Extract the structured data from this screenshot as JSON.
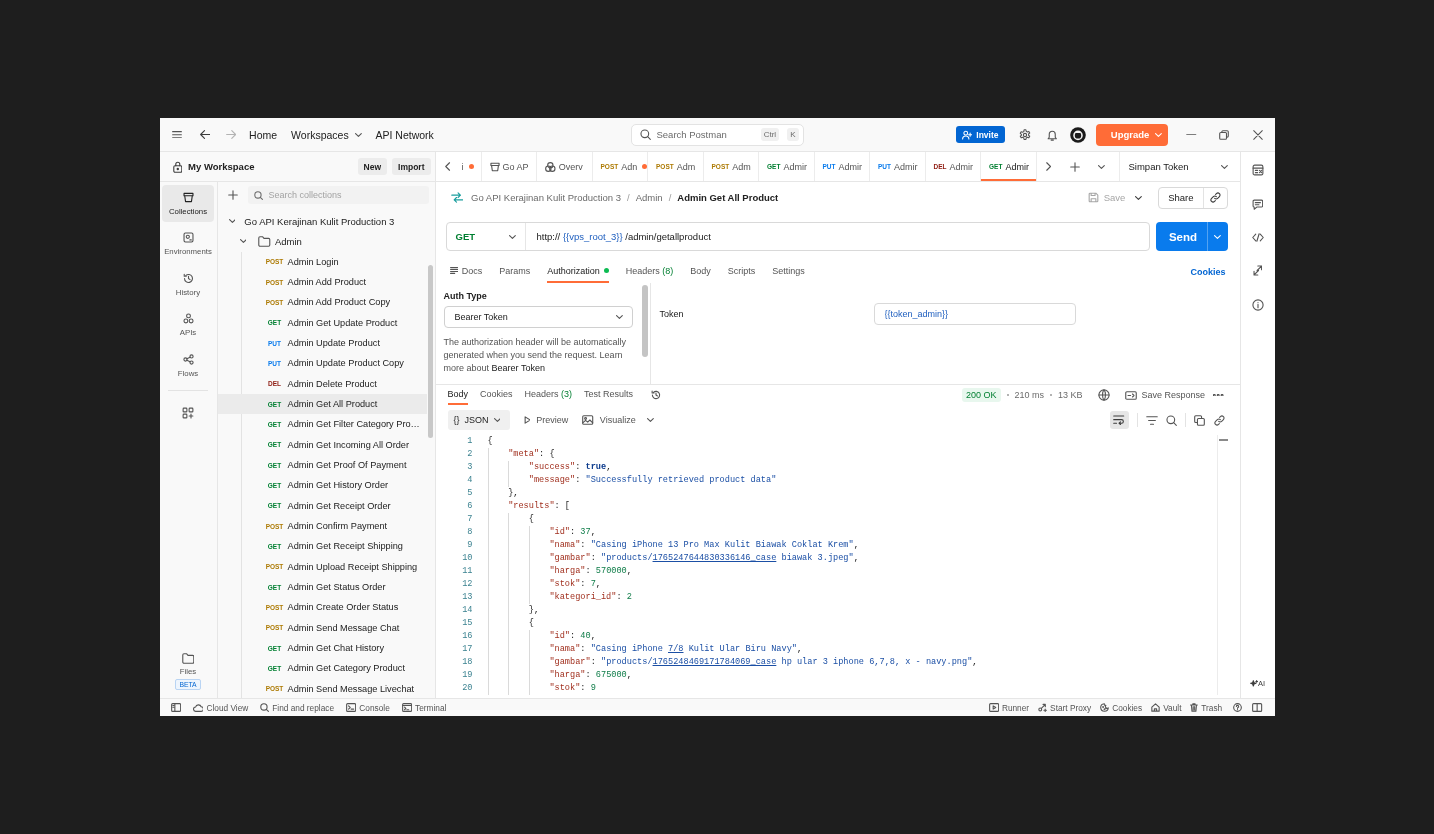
{
  "title_bar": {
    "nav": [
      {
        "label": "Home",
        "kind": "link"
      },
      {
        "label": "Workspaces",
        "kind": "menu"
      },
      {
        "label": "API Network",
        "kind": "link"
      }
    ],
    "search": {
      "placeholder": "Search Postman",
      "shortcut": [
        "Ctrl",
        "K"
      ]
    },
    "invite": "Invite",
    "upgrade": "Upgrade"
  },
  "sidebar": {
    "workspace": "My Workspace",
    "actions": [
      "New",
      "Import"
    ],
    "rail": [
      {
        "kind": "collections",
        "label": "Collections",
        "selected": true
      },
      {
        "kind": "environments",
        "label": "Environments",
        "selected": false
      },
      {
        "kind": "history",
        "label": "History",
        "selected": false
      },
      {
        "kind": "apis",
        "label": "APIs",
        "selected": false
      },
      {
        "kind": "flows",
        "label": "Flows",
        "selected": false
      }
    ],
    "files": {
      "label": "Files",
      "badge": "BETA"
    },
    "search": {
      "placeholder": "Search collections"
    },
    "tree": [
      {
        "kind": "collection",
        "name": "Go API Kerajinan Kulit Production 3",
        "expanded": true,
        "selected": false,
        "children": [
          {
            "kind": "folder",
            "name": "Admin",
            "expanded": true,
            "selected": false,
            "children": [
              {
                "kind": "post",
                "method": "POST",
                "name": "Admin Login",
                "selected": false
              },
              {
                "kind": "post",
                "method": "POST",
                "name": "Admin Add Product",
                "selected": false
              },
              {
                "kind": "post",
                "method": "POST",
                "name": "Admin Add Product Copy",
                "selected": false
              },
              {
                "kind": "get",
                "method": "GET",
                "name": "Admin Get Update Product",
                "selected": false
              },
              {
                "kind": "put",
                "method": "PUT",
                "name": "Admin Update Product",
                "selected": false
              },
              {
                "kind": "put",
                "method": "PUT",
                "name": "Admin Update Product Copy",
                "selected": false
              },
              {
                "kind": "del",
                "method": "DEL",
                "name": "Admin Delete Product",
                "selected": false
              },
              {
                "kind": "get",
                "method": "GET",
                "name": "Admin Get All Product",
                "selected": true
              },
              {
                "kind": "get",
                "method": "GET",
                "name": "Admin Get Filter Category Pro…",
                "selected": false
              },
              {
                "kind": "get",
                "method": "GET",
                "name": "Admin Get Incoming All Order",
                "selected": false
              },
              {
                "kind": "get",
                "method": "GET",
                "name": "Admin Get Proof Of Payment",
                "selected": false
              },
              {
                "kind": "get",
                "method": "GET",
                "name": "Admin Get History Order",
                "selected": false
              },
              {
                "kind": "get",
                "method": "GET",
                "name": "Admin Get Receipt Order",
                "selected": false
              },
              {
                "kind": "post",
                "method": "POST",
                "name": "Admin Confirm Payment",
                "selected": false
              },
              {
                "kind": "get",
                "method": "GET",
                "name": "Admin Get Receipt Shipping",
                "selected": false
              },
              {
                "kind": "post",
                "method": "POST",
                "name": "Admin Upload Receipt Shipping",
                "selected": false
              },
              {
                "kind": "get",
                "method": "GET",
                "name": "Admin Get Status Order",
                "selected": false
              },
              {
                "kind": "post",
                "method": "POST",
                "name": "Admin Create Order Status",
                "selected": false
              },
              {
                "kind": "post",
                "method": "POST",
                "name": "Admin Send Message Chat",
                "selected": false
              },
              {
                "kind": "get",
                "method": "GET",
                "name": "Admin Get Chat History",
                "selected": false
              },
              {
                "kind": "get",
                "method": "GET",
                "name": "Admin Get Category Product",
                "selected": false
              },
              {
                "kind": "post",
                "method": "POST",
                "name": "Admin Send Message Livechat",
                "selected": false
              }
            ]
          }
        ]
      }
    ]
  },
  "tabs": {
    "items": [
      {
        "kind": "plain",
        "label": "i",
        "unsaved": true,
        "selected": false
      },
      {
        "kind": "collection",
        "label": "Go AP",
        "unsaved": false,
        "selected": false
      },
      {
        "kind": "overview",
        "label": "Overv",
        "unsaved": false,
        "selected": false
      },
      {
        "kind": "post",
        "method": "POST",
        "label": "Adn",
        "unsaved": true,
        "selected": false
      },
      {
        "kind": "post",
        "method": "POST",
        "label": "Adm",
        "unsaved": false,
        "selected": false
      },
      {
        "kind": "post",
        "method": "POST",
        "label": "Adm",
        "unsaved": false,
        "selected": false
      },
      {
        "kind": "get",
        "method": "GET",
        "label": "Admir",
        "unsaved": false,
        "selected": false
      },
      {
        "kind": "put",
        "method": "PUT",
        "label": "Admir",
        "unsaved": false,
        "selected": false
      },
      {
        "kind": "put",
        "method": "PUT",
        "label": "Admir",
        "unsaved": false,
        "selected": false
      },
      {
        "kind": "del",
        "method": "DEL",
        "label": "Admir",
        "unsaved": false,
        "selected": false
      },
      {
        "kind": "get",
        "method": "GET",
        "label": "Admir",
        "unsaved": false,
        "selected": true
      }
    ],
    "environment": "Simpan Token"
  },
  "request": {
    "breadcrumb": {
      "items": [
        "Go API Kerajinan Kulit Production 3",
        "Admin",
        "Admin Get All Product"
      ],
      "separator": "/"
    },
    "save": {
      "label": "Save",
      "disabled": true
    },
    "share": "Share",
    "method": {
      "label": "GET",
      "kind": "get"
    },
    "url": [
      {
        "kind": "text",
        "text": "http://"
      },
      {
        "kind": "variable",
        "text": "{{vps_root_3}}"
      },
      {
        "kind": "text",
        "text": "/admin/getallproduct"
      }
    ],
    "send": "Send",
    "tabs": [
      {
        "kind": "docs",
        "label": "Docs",
        "selected": false,
        "indicator": false
      },
      {
        "kind": "plain",
        "label": "Params",
        "selected": false,
        "indicator": false
      },
      {
        "kind": "plain",
        "label": "Authorization",
        "selected": true,
        "indicator": true
      },
      {
        "kind": "plain",
        "label": "Headers",
        "count": "(8)",
        "selected": false,
        "indicator": false
      },
      {
        "kind": "plain",
        "label": "Body",
        "selected": false,
        "indicator": false
      },
      {
        "kind": "plain",
        "label": "Scripts",
        "selected": false,
        "indicator": false
      },
      {
        "kind": "plain",
        "label": "Settings",
        "selected": false,
        "indicator": false
      }
    ],
    "cookies": "Cookies",
    "auth": {
      "type_label": "Auth Type",
      "type": "Bearer Token",
      "description": "The authorization header will be automatically generated when you send the request. Learn more about",
      "link": "Bearer Token",
      "token_label": "Token",
      "token": "{{token_admin}}"
    }
  },
  "response": {
    "tabs": [
      {
        "label": "Body",
        "selected": true
      },
      {
        "label": "Cookies",
        "selected": false
      },
      {
        "label": "Headers",
        "count": "(3)",
        "selected": false
      },
      {
        "label": "Test Results",
        "selected": false
      }
    ],
    "status": "200 OK",
    "time": "210 ms",
    "size": "13 KB",
    "save_response": "Save Response",
    "format": {
      "icon": "{}",
      "label": "JSON"
    },
    "views": [
      {
        "kind": "preview",
        "label": "Preview"
      },
      {
        "kind": "visualize",
        "label": "Visualize"
      }
    ],
    "wrap_lines": true,
    "lines": [
      {
        "number": "1",
        "tokens": [
          {
            "kind": "punct",
            "text": "{"
          }
        ],
        "children": [
          {
            "number": "2",
            "tokens": [
              {
                "kind": "key",
                "text": "\"meta\""
              },
              {
                "kind": "punct",
                "text": ": {"
              }
            ],
            "children": [
              {
                "number": "3",
                "tokens": [
                  {
                    "kind": "key",
                    "text": "\"success\""
                  },
                  {
                    "kind": "punct",
                    "text": ": "
                  },
                  {
                    "kind": "bool",
                    "text": "true"
                  },
                  {
                    "kind": "punct",
                    "text": ","
                  }
                ]
              },
              {
                "number": "4",
                "tokens": [
                  {
                    "kind": "key",
                    "text": "\"message\""
                  },
                  {
                    "kind": "punct",
                    "text": ": "
                  },
                  {
                    "kind": "string",
                    "text": "\"Successfully retrieved product data\""
                  }
                ]
              }
            ]
          },
          {
            "number": "5",
            "tokens": [
              {
                "kind": "punct",
                "text": "},"
              }
            ]
          },
          {
            "number": "6",
            "tokens": [
              {
                "kind": "key",
                "text": "\"results\""
              },
              {
                "kind": "punct",
                "text": ": ["
              }
            ],
            "children": [
              {
                "number": "7",
                "tokens": [
                  {
                    "kind": "punct",
                    "text": "{"
                  }
                ],
                "children": [
                  {
                    "number": "8",
                    "tokens": [
                      {
                        "kind": "key",
                        "text": "\"id\""
                      },
                      {
                        "kind": "punct",
                        "text": ": "
                      },
                      {
                        "kind": "number",
                        "text": "37"
                      },
                      {
                        "kind": "punct",
                        "text": ","
                      }
                    ]
                  },
                  {
                    "number": "9",
                    "tokens": [
                      {
                        "kind": "key",
                        "text": "\"nama\""
                      },
                      {
                        "kind": "punct",
                        "text": ": "
                      },
                      {
                        "kind": "string",
                        "text": "\"Casing iPhone 13 Pro Max Kulit Biawak Coklat Krem\""
                      },
                      {
                        "kind": "punct",
                        "text": ","
                      }
                    ]
                  },
                  {
                    "number": "10",
                    "tokens": [
                      {
                        "kind": "key",
                        "text": "\"gambar\""
                      },
                      {
                        "kind": "punct",
                        "text": ": "
                      },
                      {
                        "kind": "string",
                        "text": "\"products/"
                      },
                      {
                        "kind": "link",
                        "text": "1765247644830336146_case"
                      },
                      {
                        "kind": "string",
                        "text": " biawak 3.jpeg\""
                      },
                      {
                        "kind": "punct",
                        "text": ","
                      }
                    ]
                  },
                  {
                    "number": "11",
                    "tokens": [
                      {
                        "kind": "key",
                        "text": "\"harga\""
                      },
                      {
                        "kind": "punct",
                        "text": ": "
                      },
                      {
                        "kind": "number",
                        "text": "570000"
                      },
                      {
                        "kind": "punct",
                        "text": ","
                      }
                    ]
                  },
                  {
                    "number": "12",
                    "tokens": [
                      {
                        "kind": "key",
                        "text": "\"stok\""
                      },
                      {
                        "kind": "punct",
                        "text": ": "
                      },
                      {
                        "kind": "number",
                        "text": "7"
                      },
                      {
                        "kind": "punct",
                        "text": ","
                      }
                    ]
                  },
                  {
                    "number": "13",
                    "tokens": [
                      {
                        "kind": "key",
                        "text": "\"kategori_id\""
                      },
                      {
                        "kind": "punct",
                        "text": ": "
                      },
                      {
                        "kind": "number",
                        "text": "2"
                      }
                    ]
                  }
                ]
              },
              {
                "number": "14",
                "tokens": [
                  {
                    "kind": "punct",
                    "text": "},"
                  }
                ]
              },
              {
                "number": "15",
                "tokens": [
                  {
                    "kind": "punct",
                    "text": "{"
                  }
                ],
                "children": [
                  {
                    "number": "16",
                    "tokens": [
                      {
                        "kind": "key",
                        "text": "\"id\""
                      },
                      {
                        "kind": "punct",
                        "text": ": "
                      },
                      {
                        "kind": "number",
                        "text": "40"
                      },
                      {
                        "kind": "punct",
                        "text": ","
                      }
                    ]
                  },
                  {
                    "number": "17",
                    "tokens": [
                      {
                        "kind": "key",
                        "text": "\"nama\""
                      },
                      {
                        "kind": "punct",
                        "text": ": "
                      },
                      {
                        "kind": "string",
                        "text": "\"Casing iPhone "
                      },
                      {
                        "kind": "link",
                        "text": "7/8"
                      },
                      {
                        "kind": "string",
                        "text": " Kulit Ular Biru Navy\""
                      },
                      {
                        "kind": "punct",
                        "text": ","
                      }
                    ]
                  },
                  {
                    "number": "18",
                    "tokens": [
                      {
                        "kind": "key",
                        "text": "\"gambar\""
                      },
                      {
                        "kind": "punct",
                        "text": ": "
                      },
                      {
                        "kind": "string",
                        "text": "\"products/"
                      },
                      {
                        "kind": "link",
                        "text": "1765248469171784069_case"
                      },
                      {
                        "kind": "string",
                        "text": " hp ular 3 iphone 6,7,8, x - navy.png\""
                      },
                      {
                        "kind": "punct",
                        "text": ","
                      }
                    ]
                  },
                  {
                    "number": "19",
                    "tokens": [
                      {
                        "kind": "key",
                        "text": "\"harga\""
                      },
                      {
                        "kind": "punct",
                        "text": ": "
                      },
                      {
                        "kind": "number",
                        "text": "675000"
                      },
                      {
                        "kind": "punct",
                        "text": ","
                      }
                    ]
                  },
                  {
                    "number": "20",
                    "tokens": [
                      {
                        "kind": "key",
                        "text": "\"stok\""
                      },
                      {
                        "kind": "punct",
                        "text": ": "
                      },
                      {
                        "kind": "number",
                        "text": "9"
                      }
                    ]
                  }
                ]
              }
            ]
          }
        ]
      }
    ]
  },
  "right_rail": {
    "assistant": "AI"
  },
  "status_bar": {
    "left": [
      {
        "kind": "cloud",
        "label": "Cloud View"
      },
      {
        "kind": "find",
        "label": "Find and replace"
      },
      {
        "kind": "console",
        "label": "Console"
      },
      {
        "kind": "terminal",
        "label": "Terminal"
      }
    ],
    "right": [
      {
        "kind": "runner",
        "label": "Runner"
      },
      {
        "kind": "proxy",
        "label": "Start Proxy"
      },
      {
        "kind": "cookies",
        "label": "Cookies"
      },
      {
        "kind": "vault",
        "label": "Vault"
      },
      {
        "kind": "trash",
        "label": "Trash"
      }
    ]
  }
}
